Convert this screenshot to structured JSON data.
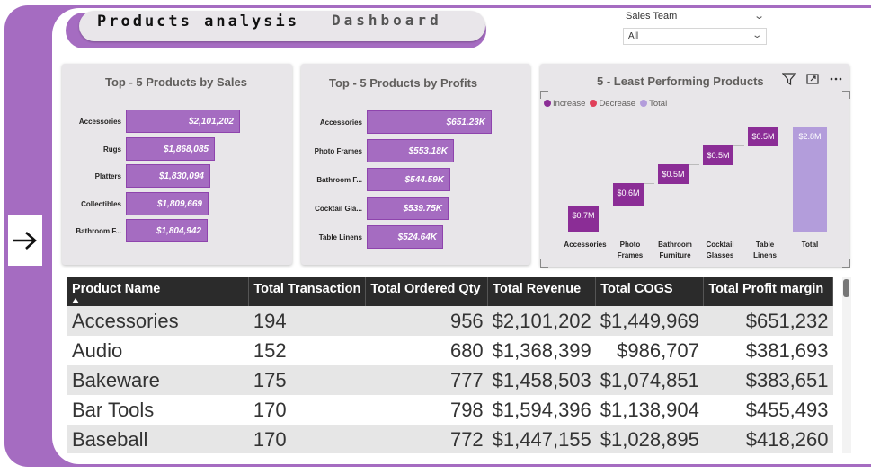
{
  "title": {
    "main": "Products analysis",
    "sub": "Dashboard"
  },
  "slicer": {
    "label": "Sales Team",
    "value": "All"
  },
  "nav": {
    "arrow_icon": "arrow-right-icon"
  },
  "sales_chart": {
    "title": "Top - 5 Products by Sales",
    "chart_data": {
      "type": "bar",
      "categories": [
        "Accessories",
        "Rugs",
        "Platters",
        "Collectibles",
        "Bathroom F..."
      ],
      "values": [
        2101202,
        1868085,
        1830094,
        1809669,
        1804942
      ],
      "labels": [
        "$2,101,202",
        "$1,868,085",
        "$1,830,094",
        "$1,809,669",
        "$1,804,942"
      ]
    }
  },
  "profit_chart": {
    "title": "Top - 5 Products by Profits",
    "chart_data": {
      "type": "bar",
      "categories": [
        "Accessories",
        "Photo Frames",
        "Bathroom F...",
        "Cocktail Gla...",
        "Table Linens"
      ],
      "values": [
        651.23,
        553.18,
        544.59,
        539.75,
        524.64
      ],
      "labels": [
        "$651.23K",
        "$553.18K",
        "$544.59K",
        "$539.75K",
        "$524.64K"
      ]
    }
  },
  "waterfall": {
    "title": "5 - Least Performing Products",
    "legend": [
      {
        "label": "Increase",
        "color": "#8b2d96"
      },
      {
        "label": "Decrease",
        "color": "#e0405a"
      },
      {
        "label": "Total",
        "color": "#b39ddb"
      }
    ],
    "chart_data": {
      "type": "bar",
      "subtype": "waterfall",
      "categories": [
        "Accessories",
        "Photo Frames",
        "Bathroom Furniture",
        "Cocktail Glasses",
        "Table Linens",
        "Total"
      ],
      "x_label_lines": [
        [
          "Accessories"
        ],
        [
          "Photo",
          "Frames"
        ],
        [
          "Bathroom",
          "Furniture"
        ],
        [
          "Cocktail",
          "Glasses"
        ],
        [
          "Table",
          "Linens"
        ],
        [
          "Total"
        ]
      ],
      "values": [
        0.7,
        0.6,
        0.5,
        0.5,
        0.5,
        2.8
      ],
      "labels": [
        "$0.7M",
        "$0.6M",
        "$0.5M",
        "$0.5M",
        "$0.5M",
        "$2.8M"
      ]
    },
    "toolbar": [
      "filter-icon",
      "focus-mode-icon",
      "more-options-icon"
    ]
  },
  "table": {
    "columns": [
      "Product Name",
      "Total Transaction",
      "Total Ordered Qty",
      "Total Revenue",
      "Total COGS",
      "Total Profit margin"
    ],
    "rows": [
      [
        "Accessories",
        "194",
        "956",
        "$2,101,202",
        "$1,449,969",
        "$651,232"
      ],
      [
        "Audio",
        "152",
        "680",
        "$1,368,399",
        "$986,707",
        "$381,693"
      ],
      [
        "Bakeware",
        "175",
        "777",
        "$1,458,503",
        "$1,074,851",
        "$383,651"
      ],
      [
        "Bar Tools",
        "170",
        "798",
        "$1,594,396",
        "$1,138,904",
        "$455,493"
      ],
      [
        "Baseball",
        "170",
        "772",
        "$1,447,155",
        "$1,028,895",
        "$418,260"
      ]
    ]
  }
}
